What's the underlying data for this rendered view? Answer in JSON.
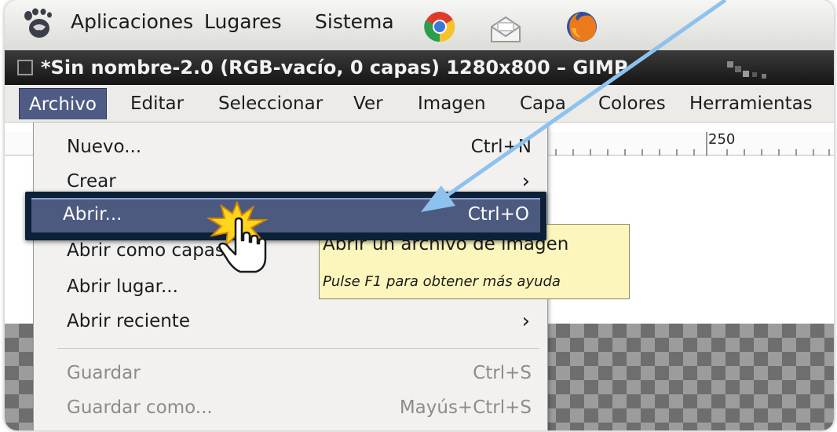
{
  "panel": {
    "items": [
      "Aplicaciones",
      "Lugares",
      "Sistema"
    ],
    "launchers": [
      "chrome-icon",
      "mail-icon",
      "firefox-icon"
    ]
  },
  "window": {
    "title": "*Sin nombre-2.0 (RGB-vacío, 0 capas) 1280x800 – GIMP"
  },
  "menubar": {
    "items": [
      "Archivo",
      "Editar",
      "Seleccionar",
      "Ver",
      "Imagen",
      "Capa",
      "Colores",
      "Herramientas"
    ],
    "active": "Archivo"
  },
  "ruler": {
    "label": "250"
  },
  "dropdown": {
    "items": [
      {
        "label": "Nuevo...",
        "accel": "Ctrl+N"
      },
      {
        "label": "Crear",
        "accel": "›"
      },
      {
        "label": "Abrir...",
        "accel": "Ctrl+O"
      },
      {
        "label": "Abrir como capas...",
        "accel": ""
      },
      {
        "label": "Abrir lugar...",
        "accel": ""
      },
      {
        "label": "Abrir reciente",
        "accel": "›"
      },
      {
        "label": "Guardar",
        "accel": "Ctrl+S"
      },
      {
        "label": "Guardar como...",
        "accel": "Mayús+Ctrl+S"
      }
    ]
  },
  "tooltip": {
    "title": "Abrir un archivo de imagen",
    "hint": "Pulse F1 para obtener más ayuda"
  },
  "colors": {
    "highlight": "#4c5a80",
    "annotation_arrow": "#8ec2ee",
    "tooltip_bg": "#fcf6bd"
  }
}
